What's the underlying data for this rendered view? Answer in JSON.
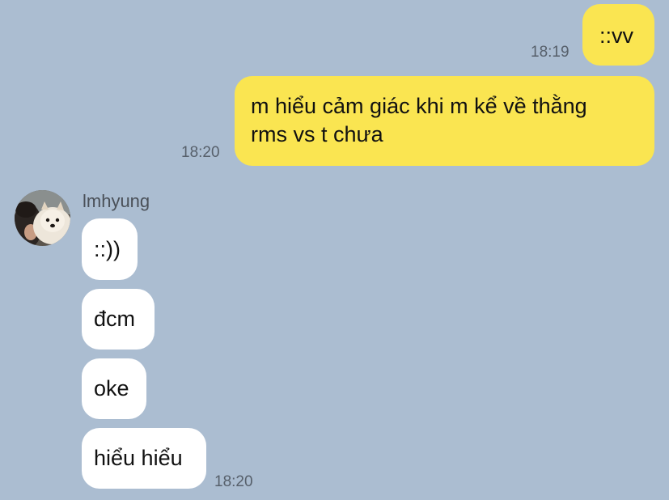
{
  "theme": {
    "background": "#abbdd1",
    "my_bubble": "#fae551",
    "their_bubble": "#ffffff"
  },
  "messages": [
    {
      "from": "me",
      "text": "::vv",
      "time": "18:19"
    },
    {
      "from": "me",
      "text_lines": [
        "m hiểu cảm giác khi m kể về thằng",
        "rms vs t chưa"
      ],
      "time": "18:20"
    }
  ],
  "contact": {
    "name": "lmhyung",
    "avatar_icon": "profile-photo-dog-avatar-icon"
  },
  "incoming": [
    {
      "text": "::))"
    },
    {
      "text": "đcm"
    },
    {
      "text": "oke"
    },
    {
      "text": "hiểu hiểu",
      "time": "18:20"
    }
  ]
}
